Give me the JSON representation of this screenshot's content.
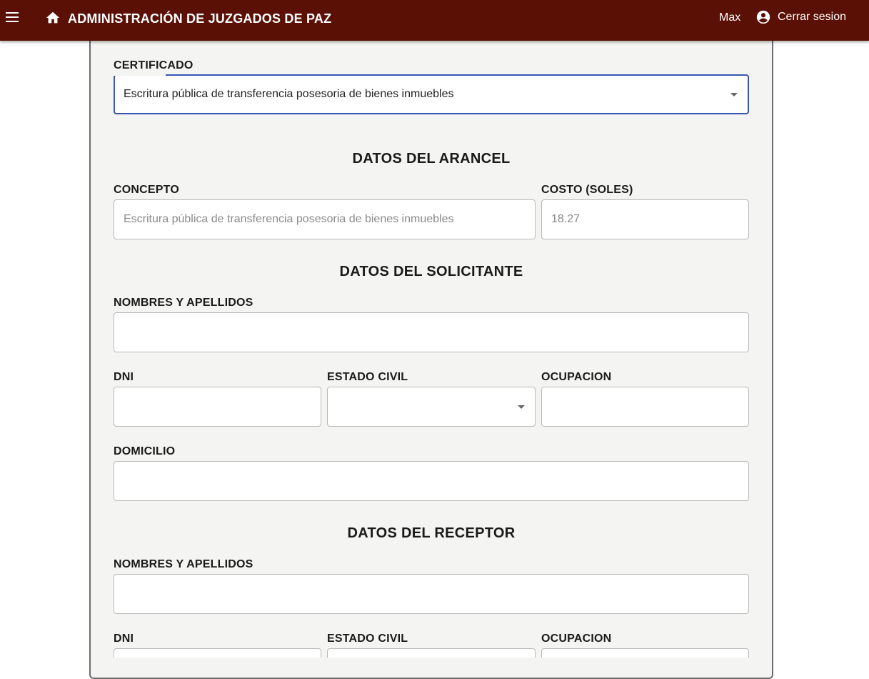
{
  "app": {
    "title": "ADMINISTRACIÓN DE JUZGADOS DE PAZ",
    "user": "Max",
    "logout_label": "Cerrar sesion",
    "accent_color": "#5a1005"
  },
  "certificado": {
    "label": "CERTIFICADO",
    "selected": "Escritura pública de transferencia posesoria de bienes inmuebles"
  },
  "arancel": {
    "title": "DATOS DEL ARANCEL",
    "concepto_label": "CONCEPTO",
    "concepto_value": "Escritura pública de transferencia posesoria de bienes inmuebles",
    "costo_label": "COSTO (SOLES)",
    "costo_value": "18.27"
  },
  "solicitante": {
    "title": "DATOS DEL SOLICITANTE",
    "nombres_label": "NOMBRES Y APELLIDOS",
    "nombres_value": "",
    "dni_label": "DNI",
    "dni_value": "",
    "estado_civil_label": "ESTADO CIVIL",
    "estado_civil_value": "",
    "ocupacion_label": "OCUPACION",
    "ocupacion_value": "",
    "domicilio_label": "DOMICILIO",
    "domicilio_value": ""
  },
  "receptor": {
    "title": "DATOS DEL RECEPTOR",
    "nombres_label": "NOMBRES Y APELLIDOS",
    "nombres_value": "",
    "dni_label": "DNI",
    "dni_value": "",
    "estado_civil_label": "ESTADO CIVIL",
    "estado_civil_value": "",
    "ocupacion_label": "OCUPACION",
    "ocupacion_value": ""
  }
}
